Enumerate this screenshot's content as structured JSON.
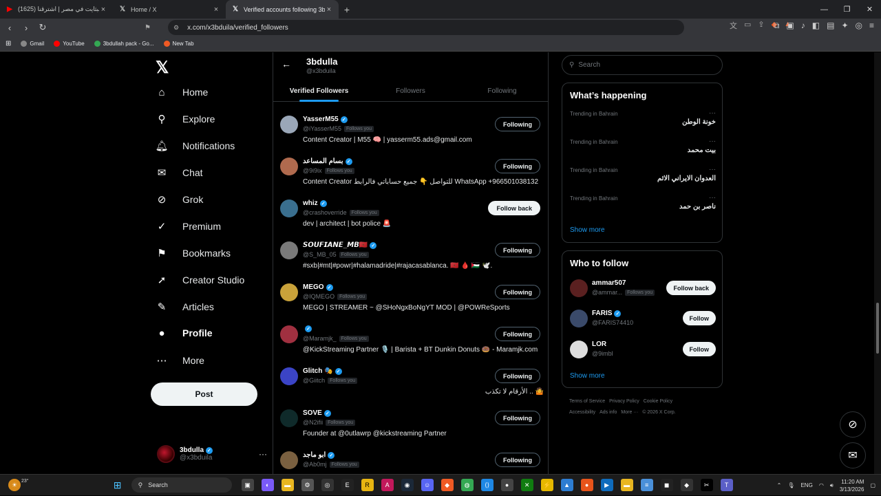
{
  "browser": {
    "tabs": [
      {
        "title": "(1625) البثايت في مصر | اشترقنا",
        "favicon": "youtube-icon",
        "active": false
      },
      {
        "title": "Home / X",
        "favicon": "x-icon",
        "active": false
      },
      {
        "title": "Verified accounts following 3bdulla",
        "favicon": "x-icon",
        "active": true
      }
    ],
    "url": "x.com/x3bduila/verified_followers",
    "bookmarks": [
      "Gmail",
      "YouTube",
      "3bdullah pack - Go...",
      "New Tab"
    ]
  },
  "nav": {
    "items": [
      {
        "label": "Home",
        "icon": "home-icon",
        "glyph": "⌂"
      },
      {
        "label": "Explore",
        "icon": "search-icon",
        "glyph": "⚲"
      },
      {
        "label": "Notifications",
        "icon": "bell-icon",
        "glyph": "🔔︎"
      },
      {
        "label": "Chat",
        "icon": "mail-icon",
        "glyph": "✉"
      },
      {
        "label": "Grok",
        "icon": "grok-icon",
        "glyph": "⊘"
      },
      {
        "label": "Premium",
        "icon": "verified-icon",
        "glyph": "✓"
      },
      {
        "label": "Bookmarks",
        "icon": "bookmark-icon",
        "glyph": "⚑"
      },
      {
        "label": "Creator Studio",
        "icon": "rocket-icon",
        "glyph": "➚"
      },
      {
        "label": "Articles",
        "icon": "article-icon",
        "glyph": "✎"
      },
      {
        "label": "Profile",
        "icon": "person-icon",
        "glyph": "●"
      },
      {
        "label": "More",
        "icon": "more-circle-icon",
        "glyph": "⋯"
      }
    ],
    "post_label": "Post",
    "me_name": "3bdulla",
    "me_handle": "@x3bduila"
  },
  "header": {
    "title": "3bdulla",
    "handle": "@x3bduila",
    "tabs": [
      "Verified Followers",
      "Followers",
      "Following"
    ]
  },
  "followers": [
    {
      "name": "YasserM55",
      "handle": "@iYasserM55",
      "follows_you": "Follows you",
      "bio": "Content Creator | M55 🧠 | yasserm55.ads@gmail.com",
      "button": "Following",
      "avatar": "#9aa7b8"
    },
    {
      "name": "بسام المساعد",
      "handle": "@9i9ix",
      "follows_you": "Follows you",
      "bio": "Content Creator للتواصل 👇 جميع حساباتي فالرابط WhatsApp +966501038132",
      "button": "Following",
      "avatar": "#b06a4e"
    },
    {
      "name": "whiz",
      "handle": "@crashoverride",
      "follows_you": "Follows you",
      "bio": "dev | architect | bot police 🚨",
      "button": "Follow back",
      "avatar": "#3a6f8f"
    },
    {
      "name": "𝙎𝙊𝙐𝙁𝙄𝘼𝙉𝙀_𝙈𝘽🇲🇦",
      "handle": "@S_MB_05",
      "follows_you": "Follows you",
      "bio": "#sxb|#mt|#powr|#halamadride|#rajacasablanca. 🇲🇦 🩸 🇵🇸 🕊️.",
      "button": "Following",
      "avatar": "#7a7a7a"
    },
    {
      "name": "MEGO",
      "handle": "@IQMEGO",
      "follows_you": "Follows you",
      "bio": "MEGO | STREAMER ~ @SHoNgxBoNgYT MOD | @POWReSports",
      "button": "Following",
      "avatar": "#c9a23a"
    },
    {
      "name": "",
      "handle": "@Maramjk_",
      "follows_you": "Follows you",
      "bio": "@KickStreaming Partner 🎙️ | Barista + BT Dunkin Donuts 🍩 - Maramjk.com",
      "button": "Following",
      "avatar": "#a03040"
    },
    {
      "name": "Glitch 🎭",
      "handle": "@Giitch",
      "follows_you": "Follows you",
      "bio": "الأرقام لا تكذب .. 🤷",
      "button": "Following",
      "avatar": "#3b44c6"
    },
    {
      "name": "SOVE",
      "handle": "@N2ifii",
      "follows_you": "Follows you",
      "bio": "Founder at @0utlawrp @kickstreaming Partner",
      "button": "Following",
      "avatar": "#0f2a2a"
    },
    {
      "name": "ابو ماجد",
      "handle": "@Ab0mj",
      "follows_you": "Follows you",
      "bio": "",
      "button": "Following",
      "avatar": "#7a6040"
    }
  ],
  "right": {
    "search_placeholder": "Search",
    "happening_title": "What’s happening",
    "trends": [
      {
        "context": "Trending in Bahrain",
        "topic": "خونة الوطن"
      },
      {
        "context": "Trending in Bahrain",
        "topic": "بيت محمد"
      },
      {
        "context": "Trending in Bahrain",
        "topic": "العدوان الايراني الاثم"
      },
      {
        "context": "Trending in Bahrain",
        "topic": "ناصر بن حمد"
      }
    ],
    "show_more": "Show more",
    "wtf_title": "Who to follow",
    "wtf": [
      {
        "name": "ammar507",
        "handle": "@ammar...",
        "follows_you": "Follows you",
        "button": "Follow back",
        "verified": false,
        "avatar": "#5a2020"
      },
      {
        "name": "FARIS",
        "handle": "@FARIS74410",
        "follows_you": "",
        "button": "Follow",
        "verified": true,
        "avatar": "#3a4a6a"
      },
      {
        "name": "LOR",
        "handle": "@9imbl",
        "follows_you": "",
        "button": "Follow",
        "verified": false,
        "avatar": "#dddddd"
      }
    ],
    "footer": [
      "Terms of Service",
      "Privacy Policy",
      "Cookie Policy",
      "Accessibility",
      "Ads info",
      "More ···",
      "© 2026 X Corp."
    ]
  },
  "taskbar": {
    "search": "Search",
    "weather": "23°",
    "lang": "ENG",
    "time": "11:20 AM",
    "date": "3/13/2026"
  }
}
